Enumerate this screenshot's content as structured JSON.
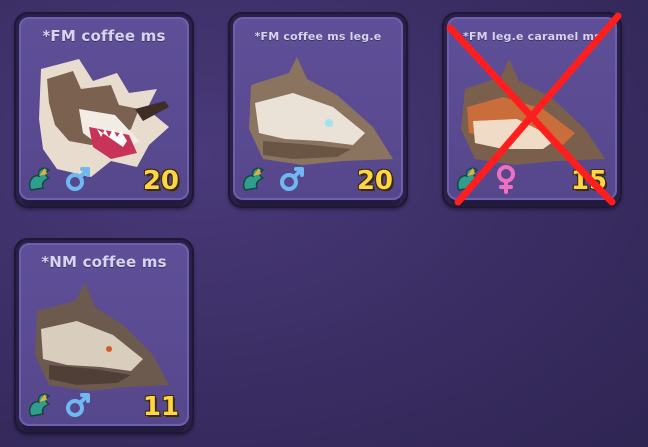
{
  "cards": [
    {
      "title": "*FM coffee ms",
      "level": "20",
      "sex": "male",
      "dragon_icon": "green-dragon-icon",
      "crossed_out": false
    },
    {
      "title": "*FM coffee ms leg.e",
      "level": "20",
      "sex": "male",
      "dragon_icon": "green-dragon-icon",
      "crossed_out": false
    },
    {
      "title": "*FM leg.e caramel ms",
      "level": "15",
      "sex": "female",
      "dragon_icon": "green-dragon-icon",
      "crossed_out": true
    },
    {
      "title": "*NM coffee ms",
      "level": "11",
      "sex": "male",
      "dragon_icon": "green-dragon-icon",
      "crossed_out": false
    }
  ],
  "colors": {
    "background": "#3d3066",
    "card_fill": "#5a4b91",
    "level_text": "#ffd540",
    "male_symbol": "#6fb8f0",
    "female_symbol": "#f070c0",
    "cross_mark": "#ff1e1e"
  }
}
